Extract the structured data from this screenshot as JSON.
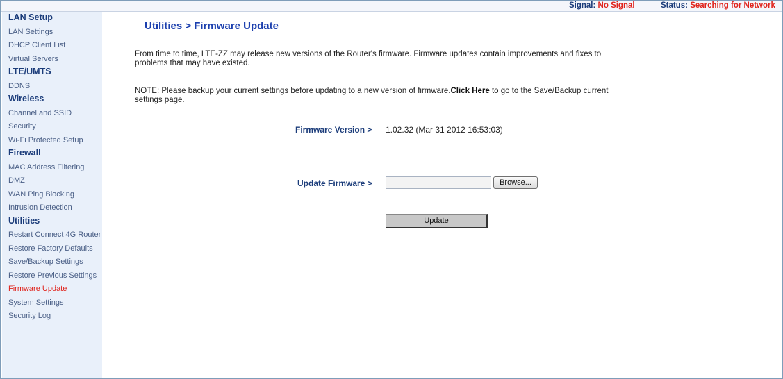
{
  "header": {
    "signal_label": "Signal:",
    "signal_value": "No Signal",
    "status_label": "Status:",
    "status_value": "Searching for Network"
  },
  "sidebar": {
    "sections": [
      {
        "heading": "LAN Setup",
        "items": [
          "LAN Settings",
          "DHCP Client List",
          "Virtual Servers"
        ]
      },
      {
        "heading": "LTE/UMTS",
        "items": [
          "DDNS"
        ]
      },
      {
        "heading": "Wireless",
        "items": [
          "Channel and SSID",
          "Security",
          "Wi-Fi Protected Setup"
        ]
      },
      {
        "heading": "Firewall",
        "items": [
          "MAC Address Filtering",
          "DMZ",
          "WAN Ping Blocking",
          "Intrusion Detection"
        ]
      },
      {
        "heading": "Utilities",
        "items": [
          "Restart Connect 4G Router",
          "Restore Factory Defaults",
          "Save/Backup Settings",
          "Restore Previous Settings",
          "Firmware Update",
          "System Settings",
          "Security Log"
        ]
      }
    ],
    "active_item": "Firmware Update",
    "active_color": "#e0231c"
  },
  "main": {
    "title": "Utilities > Firmware Update",
    "intro": "From time to time, LTE-ZZ may release new versions of the Router's firmware. Firmware updates contain improvements and fixes to problems that may have existed.",
    "note_prefix": "NOTE: Please backup your current settings before updating to a new version of firmware.",
    "note_link": "Click Here",
    "note_suffix": " to go to the Save/Backup current settings page.",
    "firmware_version_label": "Firmware Version >",
    "firmware_version_value": "1.02.32 (Mar 31 2012 16:53:03)",
    "update_firmware_label": "Update Firmware >",
    "file_input_value": "",
    "browse_label": "Browse...",
    "update_label": "Update"
  }
}
